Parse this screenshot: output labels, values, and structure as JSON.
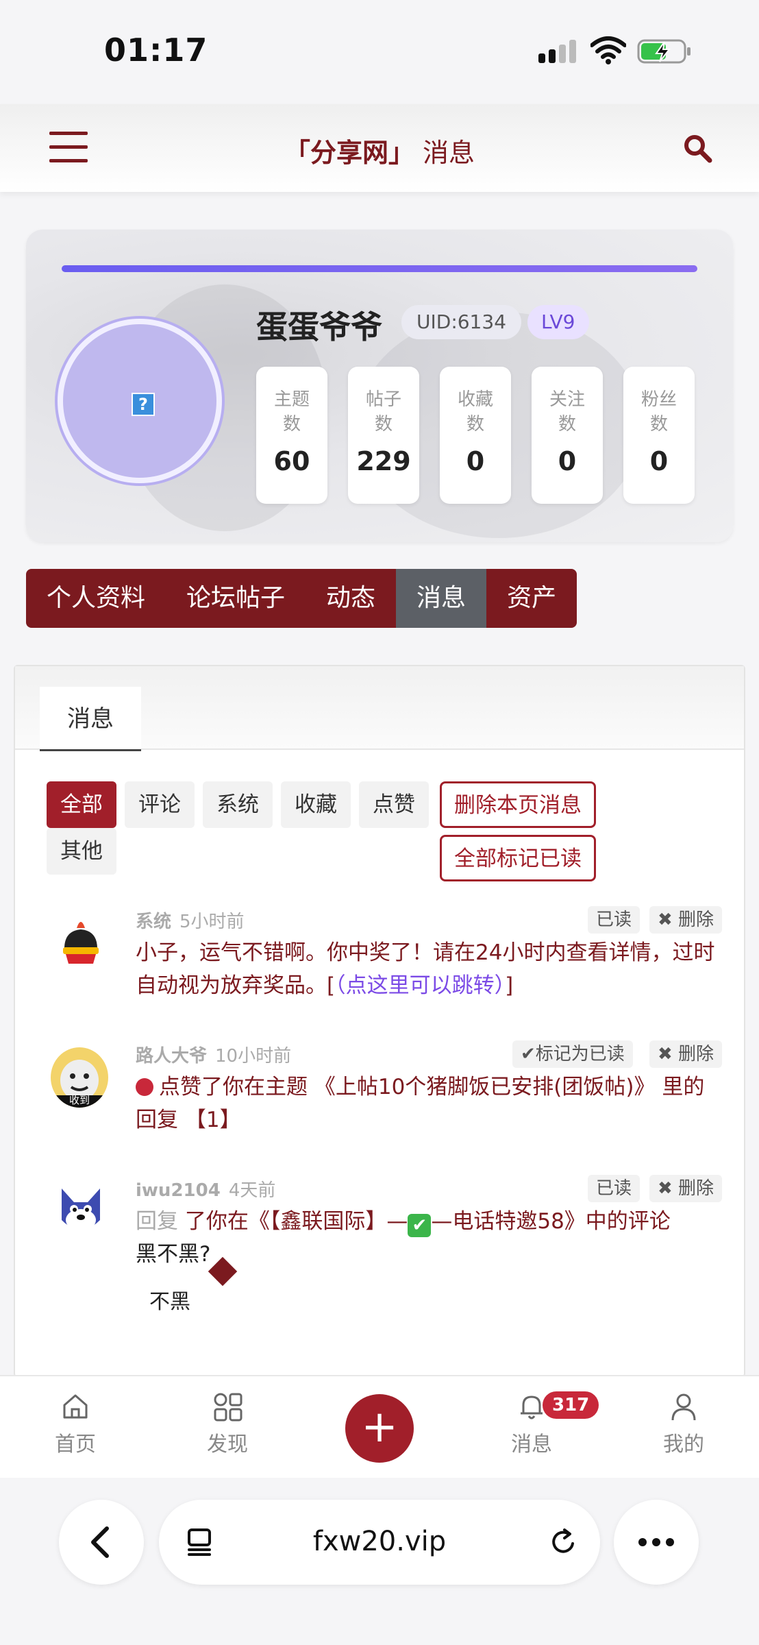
{
  "status": {
    "time": "01:17"
  },
  "header": {
    "site": "「分享网」",
    "title": "消息"
  },
  "profile": {
    "name": "蛋蛋爷爷",
    "uid": "UID:6134",
    "level": "LV9",
    "level_progress_percent": 100,
    "avatar_placeholder": "?",
    "stats": [
      {
        "label": "主题数",
        "value": "60"
      },
      {
        "label": "帖子数",
        "value": "229"
      },
      {
        "label": "收藏数",
        "value": "0"
      },
      {
        "label": "关注数",
        "value": "0"
      },
      {
        "label": "粉丝数",
        "value": "0"
      }
    ]
  },
  "nav_tabs": [
    "个人资料",
    "论坛帖子",
    "动态",
    "消息",
    "资产"
  ],
  "panel": {
    "tab": "消息",
    "filters": [
      "全部",
      "评论",
      "系统",
      "收藏",
      "点赞",
      "其他"
    ],
    "delete_page_btn": "删除本页消息",
    "mark_all_btn": "全部标记已读"
  },
  "messages": [
    {
      "sender": "系统",
      "time": "5小时前",
      "status_label": "已读",
      "delete_label": "✖ 删除",
      "text": "小子，运气不错啊。你中奖了！请在24小时内查看详情，过时自动视为放弃奖品。[",
      "link": "（点这里可以跳转）",
      "text_end": "]"
    },
    {
      "sender": "路人大爷",
      "time": "10小时前",
      "status_label": "✔标记为已读",
      "delete_label": "✖ 删除",
      "text": "点赞了你在主题 《上帖10个猪脚饭已安排(团饭帖)》 里的回复 【1】",
      "avatar_caption": "收到"
    },
    {
      "sender": "iwu2104",
      "time": "4天前",
      "status_label": "已读",
      "delete_label": "✖ 删除",
      "prefix": "回复",
      "text_a": "了你在《【鑫联国际】—",
      "check": "✔",
      "text_b": "—电话特邀58》中的评论",
      "quote": "黑不黑?",
      "reply": "不黑"
    }
  ],
  "bottom_nav": [
    {
      "label": "首页"
    },
    {
      "label": "发现"
    },
    {
      "label": "+"
    },
    {
      "label": "消息",
      "badge": "317"
    },
    {
      "label": "我的"
    }
  ],
  "browser": {
    "url": "fxw20.vip"
  },
  "colors": {
    "brand": "#7b1a1f",
    "accent": "#a11f2a",
    "progress": "#6a5df0",
    "badge": "#c8283a"
  }
}
